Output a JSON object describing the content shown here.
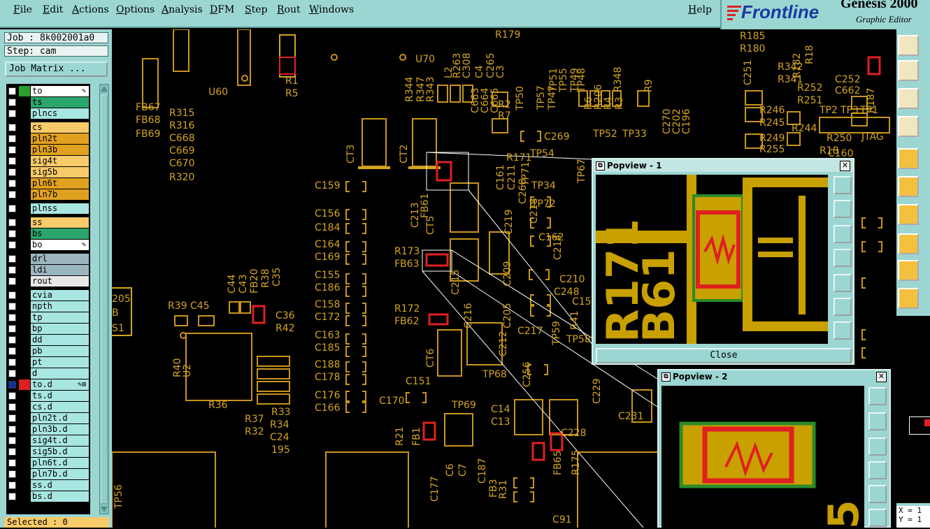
{
  "menu": {
    "file": "File",
    "edit": "Edit",
    "actions": "Actions",
    "options": "Options",
    "analysis": "Analysis",
    "dfm": "DFM",
    "step": "Step",
    "rout": "Rout",
    "windows": "Windows",
    "help": "Help"
  },
  "brand": {
    "logo": "Frontline",
    "product": "Genesis 2000",
    "subtitle": "Graphic Editor"
  },
  "job": {
    "job_label": "Job : 8k002001a0",
    "step_label": "Step: cam",
    "matrix_button": "Job Matrix ..."
  },
  "layers": [
    {
      "name": "to",
      "color": "#ffffff",
      "swatch": "#2aa02a",
      "edit": "✎"
    },
    {
      "name": "ts",
      "color": "#2aa56b"
    },
    {
      "name": "plncs",
      "color": "#a8e6e2"
    },
    {
      "name": "cs",
      "color": "#f7ca6a"
    },
    {
      "name": "pln2t",
      "color": "#e0a020"
    },
    {
      "name": "pln3b",
      "color": "#e0a020"
    },
    {
      "name": "sig4t",
      "color": "#f7ca6a"
    },
    {
      "name": "sig5b",
      "color": "#f7ca6a"
    },
    {
      "name": "pln6t",
      "color": "#e0a020"
    },
    {
      "name": "pln7b",
      "color": "#e0a020"
    },
    {
      "name": "plnss",
      "color": "#a8e6e2"
    },
    {
      "name": "ss",
      "color": "#f7ca6a"
    },
    {
      "name": "bs",
      "color": "#2aa56b"
    },
    {
      "name": "bo",
      "color": "#ffffff",
      "edit": "✎"
    },
    {
      "name": "drl",
      "color": "#9cb6c0"
    },
    {
      "name": "ldi",
      "color": "#9cb6c0"
    },
    {
      "name": "rout",
      "color": "#e8e8e8"
    },
    {
      "name": "cvia",
      "color": "#a8e6e2"
    },
    {
      "name": "npth",
      "color": "#a8e6e2"
    },
    {
      "name": "tp",
      "color": "#a8e6e2"
    },
    {
      "name": "bp",
      "color": "#a8e6e2"
    },
    {
      "name": "dd",
      "color": "#a8e6e2"
    },
    {
      "name": "pb",
      "color": "#a8e6e2"
    },
    {
      "name": "pt",
      "color": "#a8e6e2"
    },
    {
      "name": "d",
      "color": "#a8e6e2"
    },
    {
      "name": "to.d",
      "color": "#a8e6e2",
      "swatch": "#e02020",
      "check": "#1030a0",
      "edit": "✎⊞"
    },
    {
      "name": "ts.d",
      "color": "#a8e6e2"
    },
    {
      "name": "cs.d",
      "color": "#a8e6e2"
    },
    {
      "name": "pln2t.d",
      "color": "#a8e6e2"
    },
    {
      "name": "pln3b.d",
      "color": "#a8e6e2"
    },
    {
      "name": "sig4t.d",
      "color": "#a8e6e2"
    },
    {
      "name": "sig5b.d",
      "color": "#a8e6e2"
    },
    {
      "name": "pln6t.d",
      "color": "#a8e6e2"
    },
    {
      "name": "pln7b.d",
      "color": "#a8e6e2"
    },
    {
      "name": "ss.d",
      "color": "#a8e6e2"
    },
    {
      "name": "bs.d",
      "color": "#a8e6e2"
    }
  ],
  "status": {
    "selected": "Selected : 0",
    "coords": "X = 1\nY = 1"
  },
  "popview1": {
    "title": "Popview - 1",
    "close": "Close",
    "text_r171": "R171",
    "text_b61": "B61"
  },
  "popview2": {
    "title": "Popview - 2",
    "digit": "5"
  },
  "canvas_labels": [
    "R179",
    "U70",
    "R263",
    "C308",
    "C265",
    "L2",
    "C4",
    "C3",
    "TP51",
    "TP55",
    "TP57",
    "TP47",
    "TP49",
    "TP48",
    "R6",
    "R206",
    "R4",
    "R3",
    "R348",
    "R9",
    "R185",
    "R180",
    "R342",
    "R341",
    "R182",
    "R18",
    "C251",
    "C252",
    "C662",
    "R187",
    "R252",
    "R251",
    "R246",
    "R245",
    "TP2",
    "TP3",
    "TP1",
    "R249",
    "R255",
    "R244",
    "R250",
    "R18",
    "JTAG",
    "R1",
    "R5",
    "U60",
    "FB67",
    "FB68",
    "FB69",
    "R315",
    "R316",
    "C668",
    "C669",
    "C670",
    "R320",
    "R344",
    "R347",
    "R343",
    "C663",
    "C664",
    "C665",
    "R2",
    "R7",
    "TP50",
    "C269",
    "TP54",
    "TP52",
    "TP33",
    "C270",
    "C202",
    "C196",
    "CT3",
    "CT2",
    "C159",
    "C156",
    "C184",
    "C164",
    "C169",
    "C155",
    "C186",
    "C158",
    "C172",
    "C163",
    "C185",
    "C188",
    "C178",
    "C176",
    "C166",
    "R173",
    "FB63",
    "R172",
    "FB62",
    "C213",
    "CT5",
    "C219",
    "C215",
    "C209",
    "C216",
    "C205",
    "C212",
    "C256",
    "C217",
    "TP58",
    "TP59",
    "TP68",
    "C151",
    "C170",
    "CT6",
    "TP69",
    "C14",
    "C13",
    "C229",
    "C228",
    "C231",
    "R21",
    "FB1",
    "C6",
    "C7",
    "C177",
    "C187",
    "FB3",
    "R31",
    "FB65",
    "R175",
    "C91",
    "TP34",
    "C218",
    "TP72",
    "C162",
    "C214",
    "C210",
    "C248",
    "C15",
    "R41",
    "R39",
    "C45",
    "C44",
    "C43",
    "FB20",
    "R38",
    "C35",
    "C36",
    "R42",
    "R40",
    "U2",
    "R36",
    "R37",
    "R32",
    "R33",
    "R34",
    "C24",
    "195",
    "205",
    "B",
    "S1",
    "TP56",
    "TP71",
    "TP67",
    "C160",
    "C161",
    "C211",
    "C268",
    "R171",
    "FB61"
  ]
}
